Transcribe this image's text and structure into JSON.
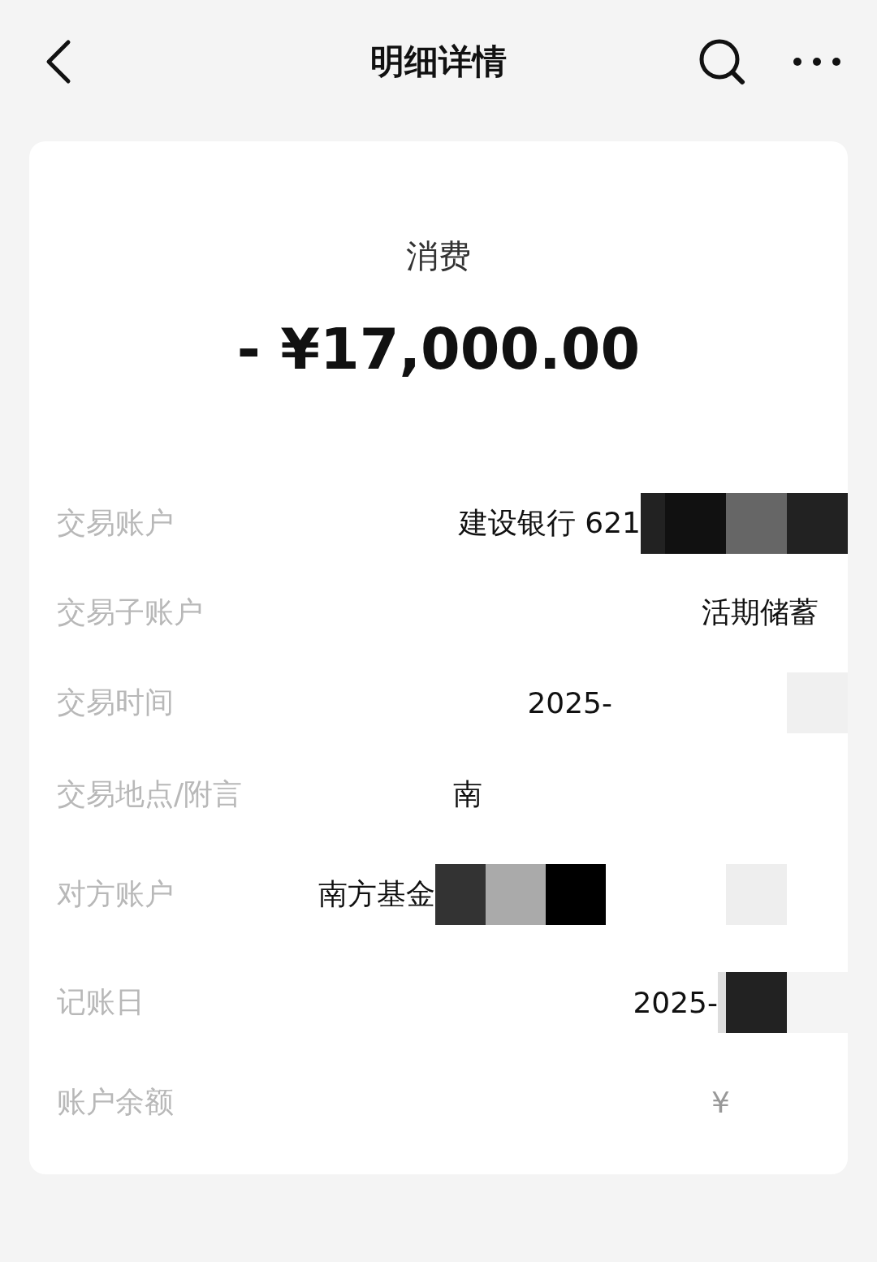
{
  "header": {
    "title": "明细详情"
  },
  "summary": {
    "type": "消费",
    "amount": "- ¥17,000.00"
  },
  "details": [
    {
      "label": "交易账户",
      "value": "建设银行 621",
      "redacted": true
    },
    {
      "label": "交易子账户",
      "value": "活期储蓄",
      "redacted": false
    },
    {
      "label": "交易时间",
      "value": "2025-",
      "redacted": true
    },
    {
      "label": "交易地点/附言",
      "value": "南",
      "redacted": true
    },
    {
      "label": "对方账户",
      "value": "南方基金",
      "redacted": true
    },
    {
      "label": "记账日",
      "value": "2025-",
      "redacted": true
    },
    {
      "label": "账户余额",
      "value": "¥",
      "redacted": true
    }
  ]
}
